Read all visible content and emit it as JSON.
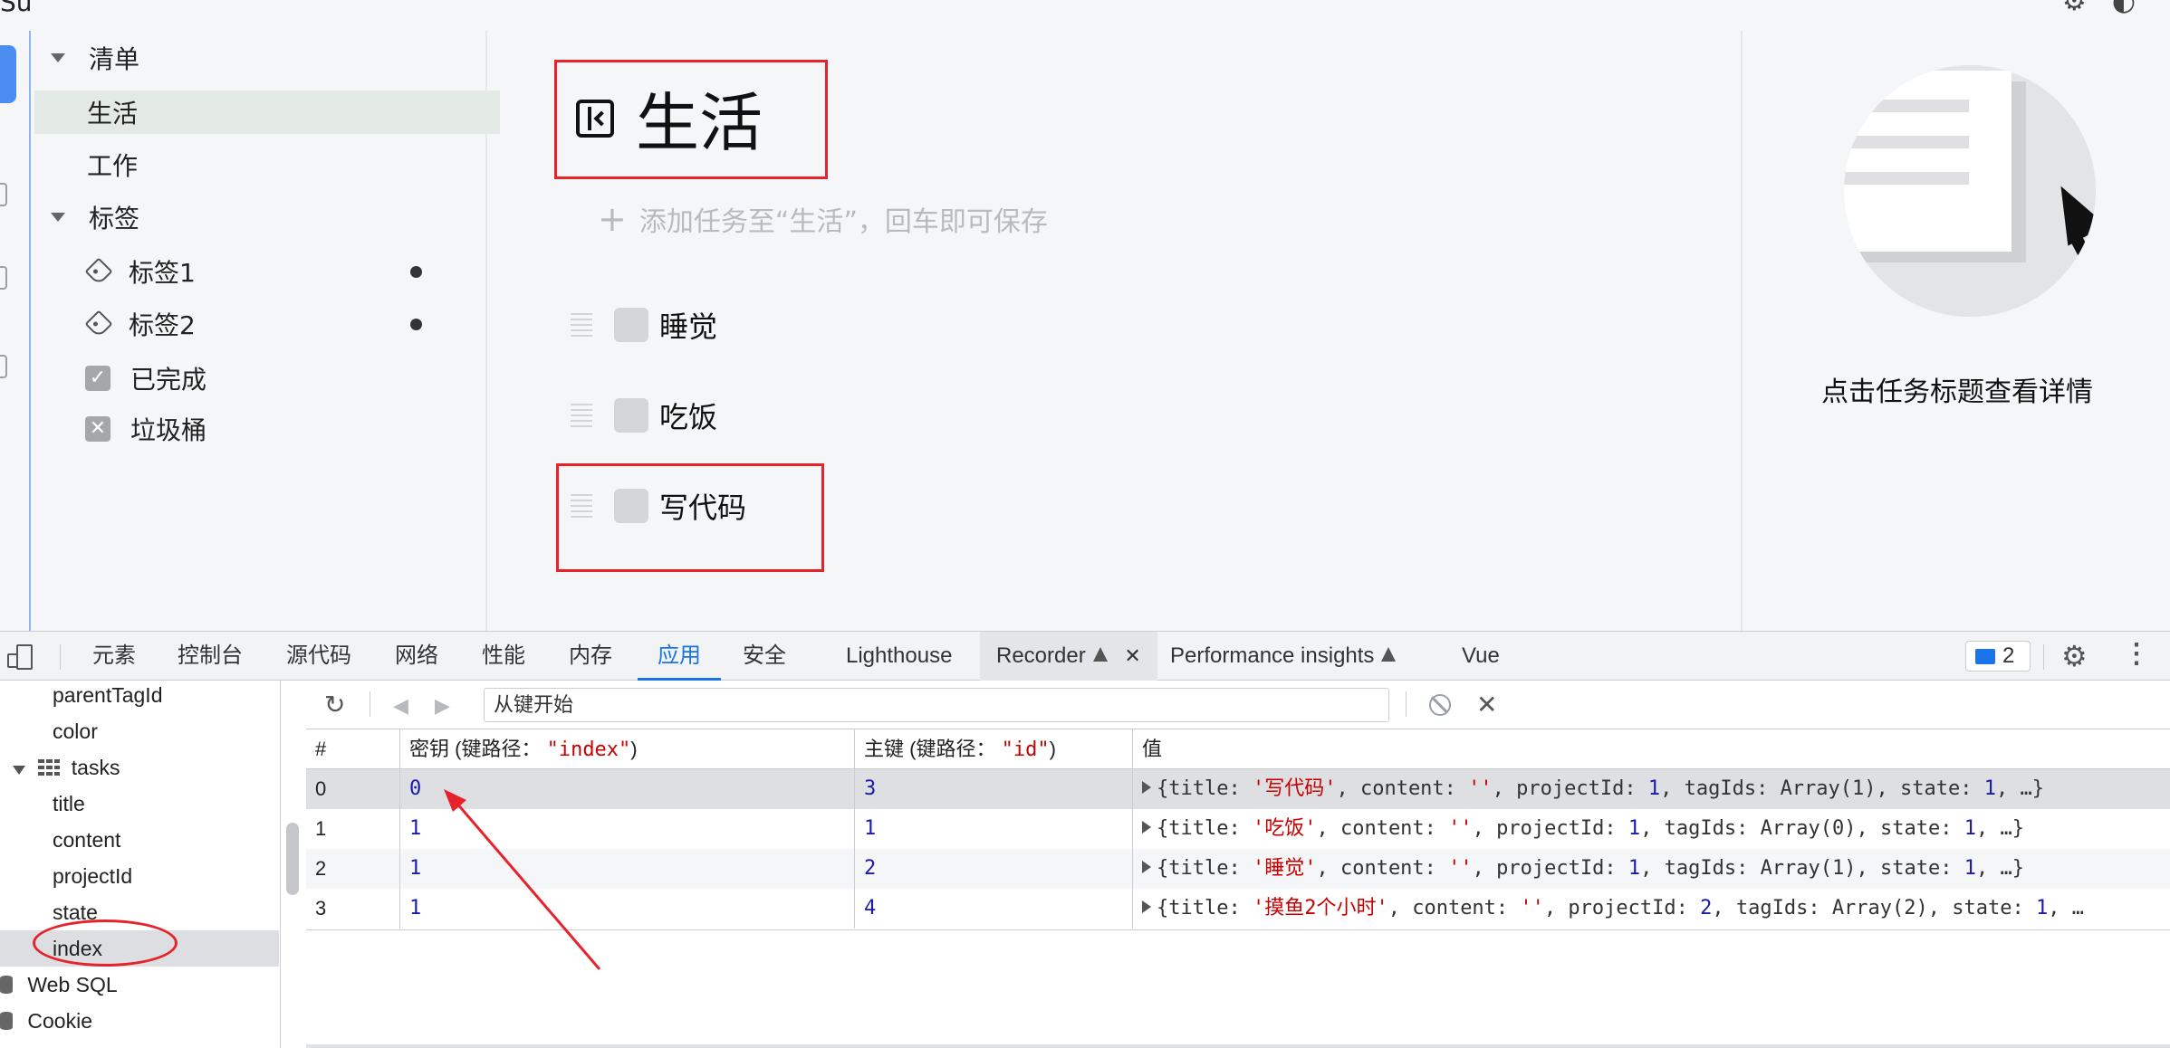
{
  "top": {
    "cut_title": "Su"
  },
  "sidebar": {
    "lists_header": "清单",
    "lists": [
      "生活",
      "工作"
    ],
    "tags_header": "标签",
    "tags": [
      "标签1",
      "标签2"
    ],
    "completed": "已完成",
    "trash": "垃圾桶"
  },
  "main": {
    "project_title": "生活",
    "add_placeholder": "添加任务至“生活”，回车即可保存",
    "tasks": [
      "睡觉",
      "吃饭",
      "写代码"
    ]
  },
  "detail": {
    "hint": "点击任务标题查看详情"
  },
  "devtools": {
    "tabs": [
      "元素",
      "控制台",
      "源代码",
      "网络",
      "性能",
      "内存",
      "应用",
      "安全",
      "Lighthouse",
      "Recorder",
      "Performance insights",
      "Vue"
    ],
    "active_tab": "应用",
    "issues_count": "2",
    "tree": [
      "parentTagId",
      "color",
      "tasks",
      "title",
      "content",
      "projectId",
      "state",
      "index",
      "Web SQL",
      "Cookie"
    ],
    "toolbar": {
      "key_input_value": "从键开始"
    },
    "table": {
      "headers": {
        "num": "#",
        "key_label": "密钥 (键路径：",
        "key_path": "\"index\"",
        "primary_label": "主键 (键路径：",
        "primary_path": "\"id\"",
        "close_paren": ")",
        "value": "值"
      },
      "rows": [
        {
          "num": "0",
          "key": "0",
          "primary": "3",
          "title": "'写代码'",
          "tag_ids": "Array(1)",
          "project_id": "1",
          "state": "1",
          "tail": ", …}"
        },
        {
          "num": "1",
          "key": "1",
          "primary": "1",
          "title": "'吃饭'",
          "tag_ids": "Array(0)",
          "project_id": "1",
          "state": "1",
          "tail": ", …}"
        },
        {
          "num": "2",
          "key": "1",
          "primary": "2",
          "title": "'睡觉'",
          "tag_ids": "Array(1)",
          "project_id": "1",
          "state": "1",
          "tail": ", …}"
        },
        {
          "num": "3",
          "key": "1",
          "primary": "4",
          "title": "'摸鱼2个小时'",
          "tag_ids": "Array(2)",
          "project_id": "2",
          "state": "1",
          "tail": ", …"
        }
      ],
      "value_tokens": {
        "open": "{",
        "title_key": "title: ",
        "content_key": ", content: ",
        "content_val": "''",
        "project_key": ", projectId: ",
        "tag_key": ", tagIds: ",
        "state_key": ", state: "
      }
    }
  },
  "colors": {
    "accent": "#1a73e8",
    "annotation": "#e8222a"
  }
}
